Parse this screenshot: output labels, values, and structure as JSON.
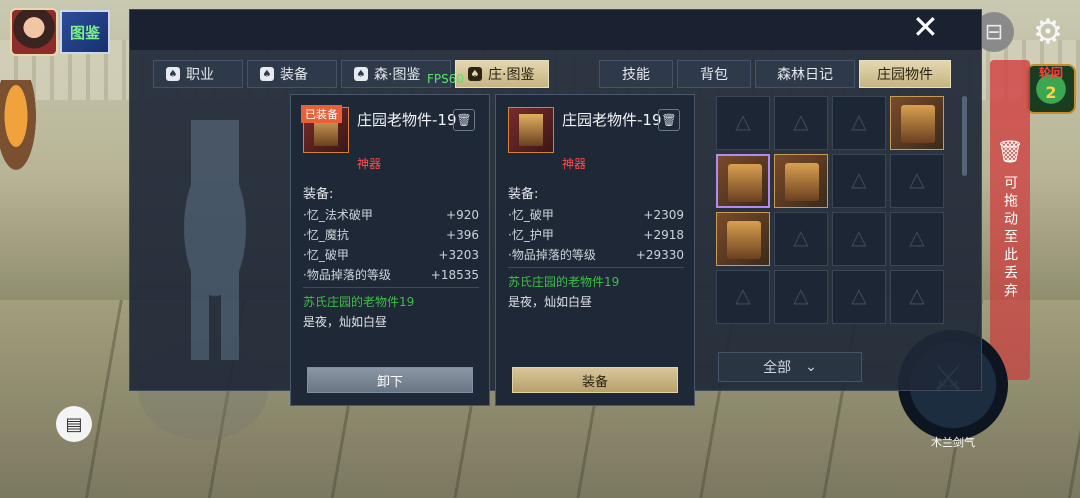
{
  "hud": {
    "tujian_label": "图鉴",
    "lunhui_label": "轮回",
    "lunhui_count": "2",
    "discard_text": "可拖动至此丢弃",
    "skill_label": "木兰剑气",
    "fps": "FPS60"
  },
  "tabs_left": [
    {
      "label": "职业"
    },
    {
      "label": "装备"
    },
    {
      "label": "森·图鉴"
    },
    {
      "label": "庄·图鉴",
      "active": true
    }
  ],
  "tabs_right": [
    {
      "label": "技能"
    },
    {
      "label": "背包"
    },
    {
      "label": "森林日记"
    },
    {
      "label": "庄园物件",
      "active": true
    }
  ],
  "filter": {
    "label": "全部"
  },
  "tooltip_equipped": {
    "badge": "已装备",
    "name": "庄园老物件-19",
    "rarity": "神器",
    "section": "装备:",
    "stats": [
      {
        "name": "·忆_法术破甲",
        "value": "+920"
      },
      {
        "name": "·忆_魔抗",
        "value": "+396"
      },
      {
        "name": "·忆_破甲",
        "value": "+3203"
      },
      {
        "name": "·物品掉落的等级",
        "value": "+18535"
      }
    ],
    "set_name": "苏氏庄园的老物件19",
    "flavor": "是夜，灿如白昼",
    "button": "卸下"
  },
  "tooltip_new": {
    "name": "庄园老物件-19",
    "rarity": "神器",
    "section": "装备:",
    "stats": [
      {
        "name": "·忆_破甲",
        "value": "+2309"
      },
      {
        "name": "·忆_护甲",
        "value": "+2918"
      },
      {
        "name": "·物品掉落的等级",
        "value": "+29330"
      }
    ],
    "set_name": "苏氏庄园的老物件19",
    "flavor": "是夜，灿如白昼",
    "button": "装备"
  }
}
